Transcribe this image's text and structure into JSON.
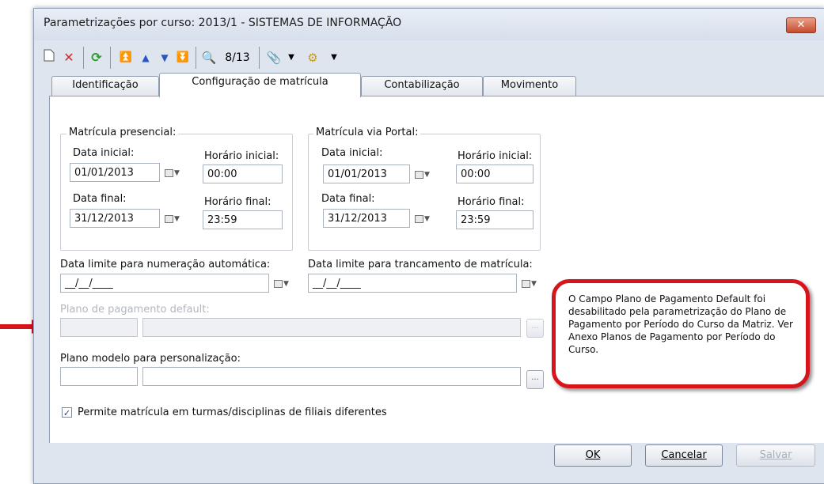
{
  "window": {
    "title": "Parametrizações por curso: 2013/1 - SISTEMAS DE INFORMAÇÃO",
    "close_label": "✕"
  },
  "toolbar": {
    "record_counter": "8/13",
    "icons": [
      "new-icon",
      "delete-icon",
      "refresh-icon",
      "first-icon",
      "previous-icon",
      "next-icon",
      "last-icon",
      "find-icon",
      "attach-icon",
      "dropdown-icon",
      "process-icon",
      "dropdown-icon"
    ]
  },
  "tabs": [
    {
      "label": "Identificação"
    },
    {
      "label": "Configuração de matrícula"
    },
    {
      "label": "Contabilização"
    },
    {
      "label": "Movimento"
    }
  ],
  "presencial": {
    "title": "Matrícula presencial:",
    "start_date_label": "Data inicial:",
    "start_date": "01/01/2013",
    "start_time_label": "Horário inicial:",
    "start_time": "00:00",
    "end_date_label": "Data final:",
    "end_date": "31/12/2013",
    "end_time_label": "Horário final:",
    "end_time": "23:59"
  },
  "portal": {
    "title": "Matrícula via Portal:",
    "start_date_label": "Data inicial:",
    "start_date": "01/01/2013",
    "start_time_label": "Horário inicial:",
    "start_time": "00:00",
    "end_date_label": "Data final:",
    "end_date": "31/12/2013",
    "end_time_label": "Horário final:",
    "end_time": "23:59"
  },
  "limits": {
    "numbering_label": "Data limite para numeração automática:",
    "numbering_value": "__/__/____",
    "lock_label": "Data limite para trancamento de matrícula:",
    "lock_value": "__/__/____"
  },
  "payment_plan": {
    "label": "Plano de pagamento default:",
    "browse_label": "..."
  },
  "model_plan": {
    "label": "Plano modelo para personalização:",
    "browse_label": "..."
  },
  "callout": {
    "text": "O Campo Plano de Pagamento Default foi desabilitado pela parametrização do Plano de Pagamento por Período do Curso da Matriz. Ver Anexo Planos de Pagamento por Período do Curso."
  },
  "checkbox": {
    "checked": true,
    "mark": "✓",
    "label": "Permite matrícula em turmas/disciplinas de filiais diferentes"
  },
  "buttons": {
    "ok": "OK",
    "cancel": "Cancelar",
    "save": "Salvar"
  },
  "colors": {
    "callout_border": "#d5141b",
    "arrow": "#d5141b",
    "close_button": "#c74b2c"
  }
}
